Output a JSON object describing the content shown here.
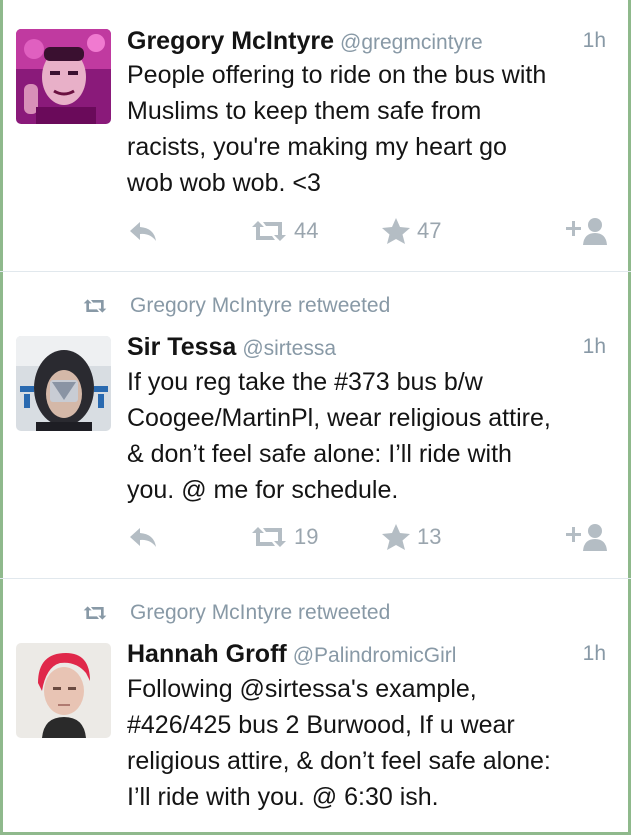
{
  "tweets": [
    {
      "name": "Gregory McIntyre",
      "handle": "@gregmcintyre",
      "time": "1h",
      "retweeted_by": "",
      "lines": [
        "People offering to ride on the bus with",
        "Muslims to keep them safe from",
        "racists, you're making my heart go",
        "wob wob wob. <3"
      ],
      "retweets": "44",
      "favorites": "47"
    },
    {
      "name": "Sir Tessa",
      "handle": "@sirtessa",
      "time": "1h",
      "retweeted_by": "Gregory McIntyre retweeted",
      "lines": [
        "If you reg take the #373 bus b/w",
        "Coogee/MartinPl, wear religious attire,",
        "& don’t feel safe alone: I’ll ride with",
        "you. @ me for schedule."
      ],
      "retweets": "19",
      "favorites": "13"
    },
    {
      "name": "Hannah Groff",
      "handle": "@PalindromicGirl",
      "time": "1h",
      "retweeted_by": "Gregory McIntyre retweeted",
      "lines": [
        "Following @sirtessa's example,",
        "#426/425 bus 2 Burwood, If u wear",
        "religious attire, & don’t feel safe alone:",
        "I’ll ride with you. @ 6:30 ish."
      ]
    }
  ],
  "icons": {
    "reply": "reply-icon",
    "retweet": "retweet-icon",
    "favorite": "star-icon",
    "follow": "follow-icon"
  },
  "colors": {
    "icon_gray": "#b4bdc4",
    "meta_gray": "#8899a6",
    "divider": "#e1e8ed",
    "frame_green": "#8fb98c"
  }
}
